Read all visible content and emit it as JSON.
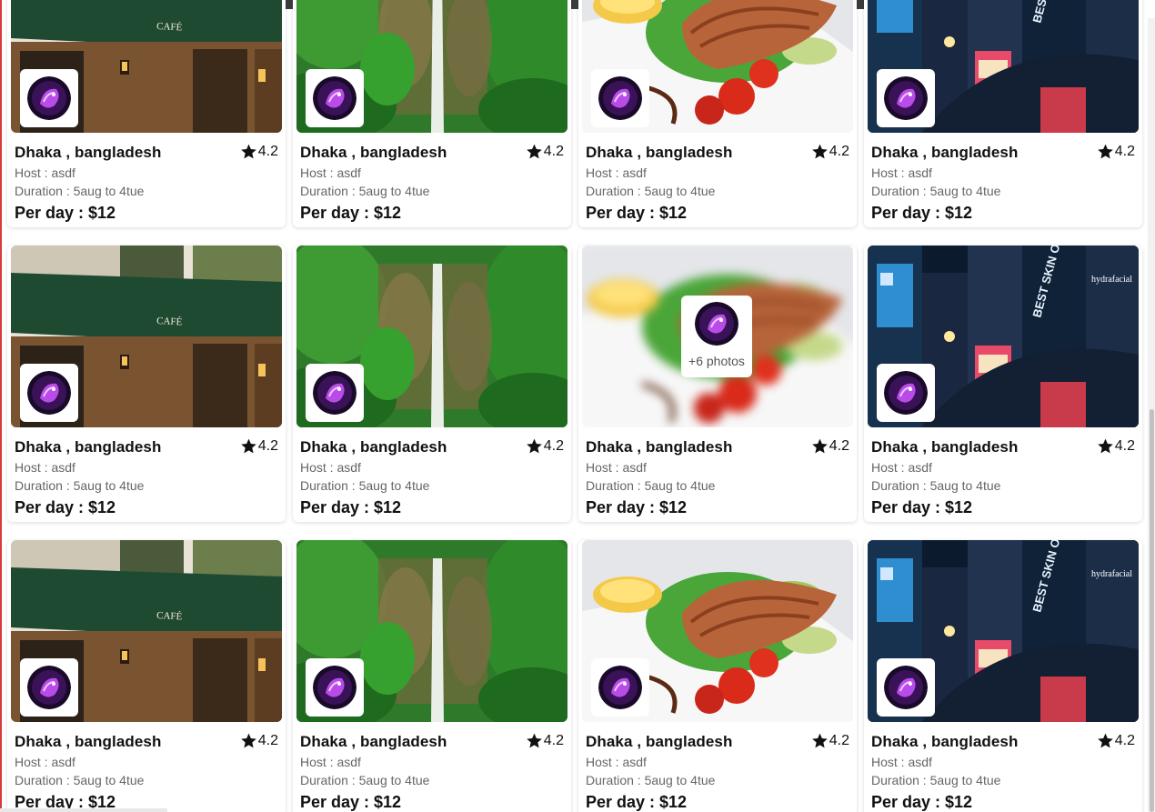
{
  "listings": [
    {
      "title": "Dhaka , bangladesh",
      "rating": "4.2",
      "host": "Host : asdf",
      "duration": "Duration : 5aug to 4tue",
      "price": "Per day : $12",
      "image": "cafe"
    },
    {
      "title": "Dhaka , bangladesh",
      "rating": "4.2",
      "host": "Host : asdf",
      "duration": "Duration : 5aug to 4tue",
      "price": "Per day : $12",
      "image": "waterfall"
    },
    {
      "title": "Dhaka , bangladesh",
      "rating": "4.2",
      "host": "Host : asdf",
      "duration": "Duration : 5aug to 4tue",
      "price": "Per day : $12",
      "image": "salmon"
    },
    {
      "title": "Dhaka , bangladesh",
      "rating": "4.2",
      "host": "Host : asdf",
      "duration": "Duration : 5aug to 4tue",
      "price": "Per day : $12",
      "image": "city"
    },
    {
      "title": "Dhaka , bangladesh",
      "rating": "4.2",
      "host": "Host : asdf",
      "duration": "Duration : 5aug to 4tue",
      "price": "Per day : $12",
      "image": "cafe"
    },
    {
      "title": "Dhaka , bangladesh",
      "rating": "4.2",
      "host": "Host : asdf",
      "duration": "Duration : 5aug to 4tue",
      "price": "Per day : $12",
      "image": "waterfall"
    },
    {
      "title": "Dhaka , bangladesh",
      "rating": "4.2",
      "host": "Host : asdf",
      "duration": "Duration : 5aug to 4tue",
      "price": "Per day : $12",
      "image": "salmon",
      "photos_overlay": "+6 photos"
    },
    {
      "title": "Dhaka , bangladesh",
      "rating": "4.2",
      "host": "Host : asdf",
      "duration": "Duration : 5aug to 4tue",
      "price": "Per day : $12",
      "image": "city"
    },
    {
      "title": "Dhaka , bangladesh",
      "rating": "4.2",
      "host": "Host : asdf",
      "duration": "Duration : 5aug to 4tue",
      "price": "Per day : $12",
      "image": "cafe"
    },
    {
      "title": "Dhaka , bangladesh",
      "rating": "4.2",
      "host": "Host : asdf",
      "duration": "Duration : 5aug to 4tue",
      "price": "Per day : $12",
      "image": "waterfall"
    },
    {
      "title": "Dhaka , bangladesh",
      "rating": "4.2",
      "host": "Host : asdf",
      "duration": "Duration : 5aug to 4tue",
      "price": "Per day : $12",
      "image": "salmon"
    },
    {
      "title": "Dhaka , bangladesh",
      "rating": "4.2",
      "host": "Host : asdf",
      "duration": "Duration : 5aug to 4tue",
      "price": "Per day : $12",
      "image": "city"
    }
  ],
  "image_texts": {
    "cafe_sign": "CAFÉ",
    "city_billboard": "BEST SKIN OF YOUR LIFE.",
    "city_brand": "hydrafacial"
  },
  "colors": {
    "star": "#111111",
    "title": "#111111",
    "meta": "#666666"
  }
}
